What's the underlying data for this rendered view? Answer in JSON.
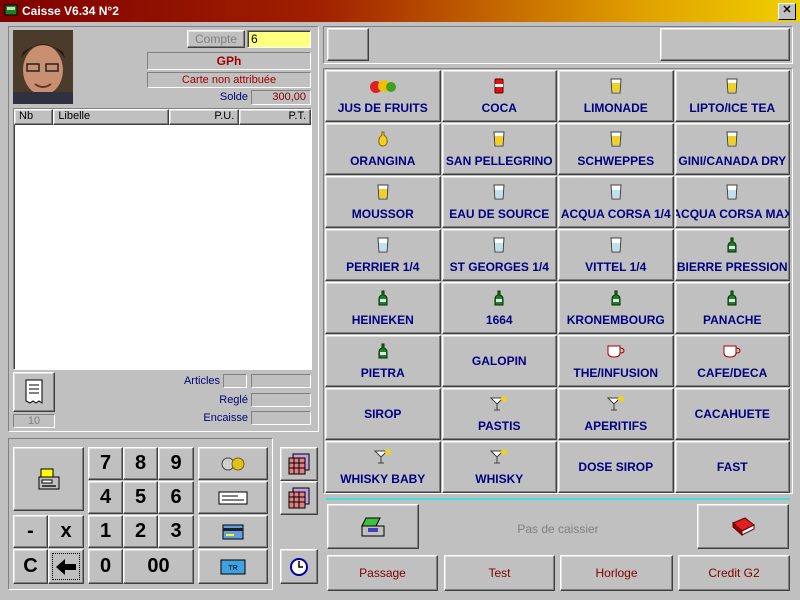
{
  "window": {
    "title": "Caisse V6.34   N°2",
    "close": "✕"
  },
  "account": {
    "compte_label": "Compte",
    "compte_value": "6",
    "name": "GPh",
    "card_status": "Carte non attribuée",
    "solde_label": "Solde",
    "solde_value": "300,00"
  },
  "ticket": {
    "columns": [
      "Nb",
      "Libelle",
      "P.U.",
      "P.T."
    ],
    "counter": "10",
    "articles_label": "Articles",
    "regle_label": "Reglé",
    "encaisse_label": "Encaisse"
  },
  "keypad": {
    "keys": [
      "7",
      "8",
      "9",
      "4",
      "5",
      "6",
      "1",
      "2",
      "3",
      "0",
      "00",
      "-",
      "x",
      "C"
    ]
  },
  "drinks": [
    {
      "label": "JUS DE FRUITS",
      "icon": "fruits-icon"
    },
    {
      "label": "COCA",
      "icon": "can-icon"
    },
    {
      "label": "LIMONADE",
      "icon": "glass-yellow-icon"
    },
    {
      "label": "LIPTO/ICE TEA",
      "icon": "glass-yellow-icon"
    },
    {
      "label": "ORANGINA",
      "icon": "orangina-bottle-icon"
    },
    {
      "label": "SAN PELLEGRINO",
      "icon": "glass-yellow-icon"
    },
    {
      "label": "SCHWEPPES",
      "icon": "glass-yellow-icon"
    },
    {
      "label": "GINI/CANADA DRY",
      "icon": "glass-yellow-icon"
    },
    {
      "label": "MOUSSOR",
      "icon": "glass-yellow-icon"
    },
    {
      "label": "EAU DE SOURCE",
      "icon": "glass-water-icon"
    },
    {
      "label": "ACQUA CORSA 1/4",
      "icon": "glass-water-icon"
    },
    {
      "label": "ACQUA CORSA MAX",
      "icon": "glass-water-icon"
    },
    {
      "label": "PERRIER 1/4",
      "icon": "glass-water-icon"
    },
    {
      "label": "ST GEORGES 1/4",
      "icon": "glass-water-icon"
    },
    {
      "label": "VITTEL 1/4",
      "icon": "glass-water-icon"
    },
    {
      "label": "BIERRE PRESSION",
      "icon": "beer-bottle-icon"
    },
    {
      "label": "HEINEKEN",
      "icon": "beer-bottle-icon"
    },
    {
      "label": "1664",
      "icon": "beer-bottle-icon"
    },
    {
      "label": "KRONEMBOURG",
      "icon": "beer-bottle-icon"
    },
    {
      "label": "PANACHE",
      "icon": "beer-bottle-icon"
    },
    {
      "label": "PIETRA",
      "icon": "beer-bottle-icon"
    },
    {
      "label": "GALOPIN",
      "icon": ""
    },
    {
      "label": "THE/INFUSION",
      "icon": "cup-icon"
    },
    {
      "label": "CAFE/DECA",
      "icon": "cup-icon"
    },
    {
      "label": "SIROP",
      "icon": ""
    },
    {
      "label": "PASTIS",
      "icon": "cocktail-icon"
    },
    {
      "label": "APERITIFS",
      "icon": "cocktail-icon"
    },
    {
      "label": "CACAHUETE",
      "icon": ""
    },
    {
      "label": "WHISKY BABY",
      "icon": "cocktail-icon"
    },
    {
      "label": "WHISKY",
      "icon": "cocktail-icon"
    },
    {
      "label": "DOSE SIROP",
      "icon": ""
    },
    {
      "label": "FAST",
      "icon": ""
    }
  ],
  "cashier": {
    "status": "Pas de caissier"
  },
  "bottom_buttons": [
    "Passage",
    "Test",
    "Horloge",
    "Credit G2"
  ],
  "colors": {
    "drink_text": "#000080",
    "bottom_text": "#800000",
    "compte_bg": "#ffff80"
  }
}
